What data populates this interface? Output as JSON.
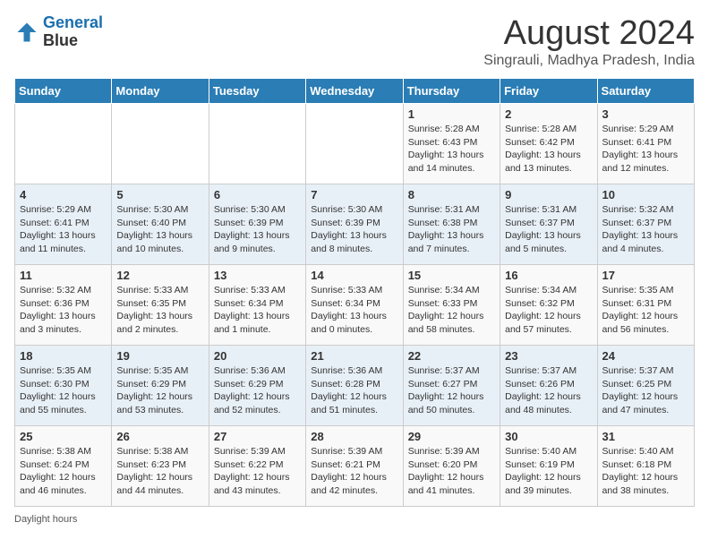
{
  "logo": {
    "line1": "General",
    "line2": "Blue"
  },
  "title": "August 2024",
  "subtitle": "Singrauli, Madhya Pradesh, India",
  "days_of_week": [
    "Sunday",
    "Monday",
    "Tuesday",
    "Wednesday",
    "Thursday",
    "Friday",
    "Saturday"
  ],
  "weeks": [
    [
      {
        "day": "",
        "info": ""
      },
      {
        "day": "",
        "info": ""
      },
      {
        "day": "",
        "info": ""
      },
      {
        "day": "",
        "info": ""
      },
      {
        "day": "1",
        "info": "Sunrise: 5:28 AM\nSunset: 6:43 PM\nDaylight: 13 hours\nand 14 minutes."
      },
      {
        "day": "2",
        "info": "Sunrise: 5:28 AM\nSunset: 6:42 PM\nDaylight: 13 hours\nand 13 minutes."
      },
      {
        "day": "3",
        "info": "Sunrise: 5:29 AM\nSunset: 6:41 PM\nDaylight: 13 hours\nand 12 minutes."
      }
    ],
    [
      {
        "day": "4",
        "info": "Sunrise: 5:29 AM\nSunset: 6:41 PM\nDaylight: 13 hours\nand 11 minutes."
      },
      {
        "day": "5",
        "info": "Sunrise: 5:30 AM\nSunset: 6:40 PM\nDaylight: 13 hours\nand 10 minutes."
      },
      {
        "day": "6",
        "info": "Sunrise: 5:30 AM\nSunset: 6:39 PM\nDaylight: 13 hours\nand 9 minutes."
      },
      {
        "day": "7",
        "info": "Sunrise: 5:30 AM\nSunset: 6:39 PM\nDaylight: 13 hours\nand 8 minutes."
      },
      {
        "day": "8",
        "info": "Sunrise: 5:31 AM\nSunset: 6:38 PM\nDaylight: 13 hours\nand 7 minutes."
      },
      {
        "day": "9",
        "info": "Sunrise: 5:31 AM\nSunset: 6:37 PM\nDaylight: 13 hours\nand 5 minutes."
      },
      {
        "day": "10",
        "info": "Sunrise: 5:32 AM\nSunset: 6:37 PM\nDaylight: 13 hours\nand 4 minutes."
      }
    ],
    [
      {
        "day": "11",
        "info": "Sunrise: 5:32 AM\nSunset: 6:36 PM\nDaylight: 13 hours\nand 3 minutes."
      },
      {
        "day": "12",
        "info": "Sunrise: 5:33 AM\nSunset: 6:35 PM\nDaylight: 13 hours\nand 2 minutes."
      },
      {
        "day": "13",
        "info": "Sunrise: 5:33 AM\nSunset: 6:34 PM\nDaylight: 13 hours\nand 1 minute."
      },
      {
        "day": "14",
        "info": "Sunrise: 5:33 AM\nSunset: 6:34 PM\nDaylight: 13 hours\nand 0 minutes."
      },
      {
        "day": "15",
        "info": "Sunrise: 5:34 AM\nSunset: 6:33 PM\nDaylight: 12 hours\nand 58 minutes."
      },
      {
        "day": "16",
        "info": "Sunrise: 5:34 AM\nSunset: 6:32 PM\nDaylight: 12 hours\nand 57 minutes."
      },
      {
        "day": "17",
        "info": "Sunrise: 5:35 AM\nSunset: 6:31 PM\nDaylight: 12 hours\nand 56 minutes."
      }
    ],
    [
      {
        "day": "18",
        "info": "Sunrise: 5:35 AM\nSunset: 6:30 PM\nDaylight: 12 hours\nand 55 minutes."
      },
      {
        "day": "19",
        "info": "Sunrise: 5:35 AM\nSunset: 6:29 PM\nDaylight: 12 hours\nand 53 minutes."
      },
      {
        "day": "20",
        "info": "Sunrise: 5:36 AM\nSunset: 6:29 PM\nDaylight: 12 hours\nand 52 minutes."
      },
      {
        "day": "21",
        "info": "Sunrise: 5:36 AM\nSunset: 6:28 PM\nDaylight: 12 hours\nand 51 minutes."
      },
      {
        "day": "22",
        "info": "Sunrise: 5:37 AM\nSunset: 6:27 PM\nDaylight: 12 hours\nand 50 minutes."
      },
      {
        "day": "23",
        "info": "Sunrise: 5:37 AM\nSunset: 6:26 PM\nDaylight: 12 hours\nand 48 minutes."
      },
      {
        "day": "24",
        "info": "Sunrise: 5:37 AM\nSunset: 6:25 PM\nDaylight: 12 hours\nand 47 minutes."
      }
    ],
    [
      {
        "day": "25",
        "info": "Sunrise: 5:38 AM\nSunset: 6:24 PM\nDaylight: 12 hours\nand 46 minutes."
      },
      {
        "day": "26",
        "info": "Sunrise: 5:38 AM\nSunset: 6:23 PM\nDaylight: 12 hours\nand 44 minutes."
      },
      {
        "day": "27",
        "info": "Sunrise: 5:39 AM\nSunset: 6:22 PM\nDaylight: 12 hours\nand 43 minutes."
      },
      {
        "day": "28",
        "info": "Sunrise: 5:39 AM\nSunset: 6:21 PM\nDaylight: 12 hours\nand 42 minutes."
      },
      {
        "day": "29",
        "info": "Sunrise: 5:39 AM\nSunset: 6:20 PM\nDaylight: 12 hours\nand 41 minutes."
      },
      {
        "day": "30",
        "info": "Sunrise: 5:40 AM\nSunset: 6:19 PM\nDaylight: 12 hours\nand 39 minutes."
      },
      {
        "day": "31",
        "info": "Sunrise: 5:40 AM\nSunset: 6:18 PM\nDaylight: 12 hours\nand 38 minutes."
      }
    ]
  ],
  "footer": "Daylight hours"
}
